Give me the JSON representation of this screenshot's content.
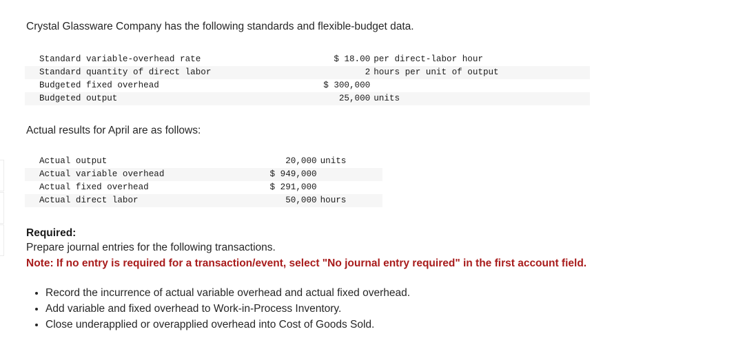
{
  "intro": {
    "text": "Crystal Glassware Company has the following standards and flexible-budget data."
  },
  "standards_table": {
    "rows": [
      {
        "label": "Standard variable-overhead rate",
        "value": "$ 18.00",
        "unit": "per direct-labor hour"
      },
      {
        "label": "Standard quantity of direct labor",
        "value": "2",
        "unit": "hours per unit of output"
      },
      {
        "label": "Budgeted fixed overhead",
        "value": "$ 300,000",
        "unit": ""
      },
      {
        "label": "Budgeted output",
        "value": "25,000",
        "unit": "units"
      }
    ]
  },
  "actual_intro": {
    "text": "Actual results for April are as follows:"
  },
  "actual_table": {
    "rows": [
      {
        "label": "Actual output",
        "value": "20,000",
        "unit": "units"
      },
      {
        "label": "Actual variable overhead",
        "value": "$ 949,000",
        "unit": ""
      },
      {
        "label": "Actual fixed overhead",
        "value": "$ 291,000",
        "unit": ""
      },
      {
        "label": "Actual direct labor",
        "value": "50,000",
        "unit": "hours"
      }
    ]
  },
  "required": {
    "heading": "Required:",
    "instruction": "Prepare journal entries for the following transactions.",
    "note": "Note: If no entry is required for a transaction/event, select \"No journal entry required\" in the first account field.",
    "note_color": "#a81c1c"
  },
  "tasks": [
    "Record the incurrence of actual variable overhead and actual fixed overhead.",
    "Add variable and fixed overhead to Work-in-Process Inventory.",
    "Close underapplied or overapplied overhead into Cost of Goods Sold."
  ]
}
